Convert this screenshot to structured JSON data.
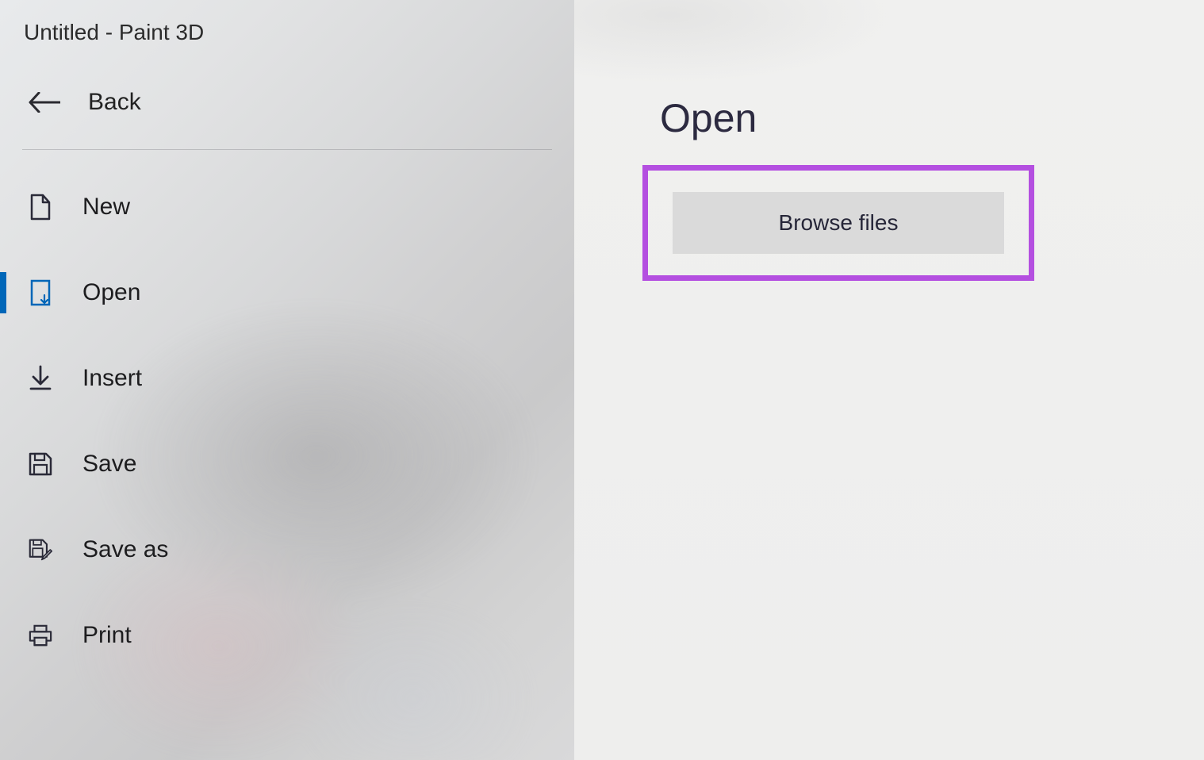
{
  "window": {
    "title": "Untitled - Paint 3D"
  },
  "back": {
    "label": "Back"
  },
  "sidebar": {
    "items": [
      {
        "key": "new",
        "label": "New",
        "icon": "document-icon",
        "selected": false
      },
      {
        "key": "open",
        "label": "Open",
        "icon": "open-icon",
        "selected": true
      },
      {
        "key": "insert",
        "label": "Insert",
        "icon": "insert-icon",
        "selected": false
      },
      {
        "key": "save",
        "label": "Save",
        "icon": "save-icon",
        "selected": false
      },
      {
        "key": "saveas",
        "label": "Save as",
        "icon": "save-as-icon",
        "selected": false
      },
      {
        "key": "print",
        "label": "Print",
        "icon": "print-icon",
        "selected": false
      }
    ]
  },
  "main": {
    "heading": "Open",
    "browse_button": "Browse files"
  },
  "colors": {
    "accent": "#0066b8",
    "highlight_border": "#b44fe0",
    "text_dark": "#1d1d1f"
  }
}
